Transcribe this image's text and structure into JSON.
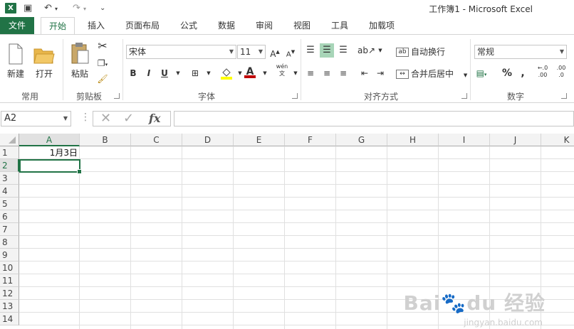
{
  "window": {
    "title": "工作簿1 - Microsoft Excel"
  },
  "colors": {
    "accent": "#217346",
    "ribbon_border": "#d4d4d4",
    "grid_line": "#e0e0e0"
  },
  "quick_access": [
    {
      "name": "save-icon",
      "glyph": "💾"
    },
    {
      "name": "undo-icon",
      "glyph": "↶"
    },
    {
      "name": "redo-icon",
      "glyph": "↷"
    },
    {
      "name": "customize-icon",
      "glyph": "⌄"
    }
  ],
  "tabs": [
    {
      "label": "文件"
    },
    {
      "label": "开始"
    },
    {
      "label": "插入"
    },
    {
      "label": "页面布局"
    },
    {
      "label": "公式"
    },
    {
      "label": "数据"
    },
    {
      "label": "审阅"
    },
    {
      "label": "视图"
    },
    {
      "label": "工具"
    },
    {
      "label": "加载项"
    }
  ],
  "ribbon": {
    "common": {
      "new_label": "新建",
      "open_label": "打开",
      "group_label": "常用"
    },
    "clipboard": {
      "paste_label": "粘贴",
      "group_label": "剪贴板"
    },
    "font": {
      "font_name": "宋体",
      "font_size": "11",
      "bold": "B",
      "italic": "I",
      "underline": "U",
      "pinyin": "wén",
      "group_label": "字体"
    },
    "alignment": {
      "wrap_label": "自动换行",
      "merge_label": "合并后居中",
      "group_label": "对齐方式"
    },
    "number": {
      "format": "常规",
      "percent": "%",
      "comma": ",",
      "inc_decimal": ".00",
      "dec_decimal": ".0",
      "group_label": "数字"
    }
  },
  "formula_bar": {
    "name_box": "A2",
    "fx": "fx",
    "formula": ""
  },
  "sheet": {
    "columns": [
      "A",
      "B",
      "C",
      "D",
      "E",
      "F",
      "G",
      "H",
      "I",
      "J",
      "K"
    ],
    "rows": [
      "1",
      "2",
      "3",
      "4",
      "5",
      "6",
      "7",
      "8",
      "9",
      "10",
      "11",
      "12",
      "13",
      "14"
    ],
    "cells": {
      "A1": "1月3日"
    },
    "active_cell": "A2"
  },
  "watermark": {
    "text": "Bai du 经验",
    "url": "jingyan.baidu.com"
  }
}
